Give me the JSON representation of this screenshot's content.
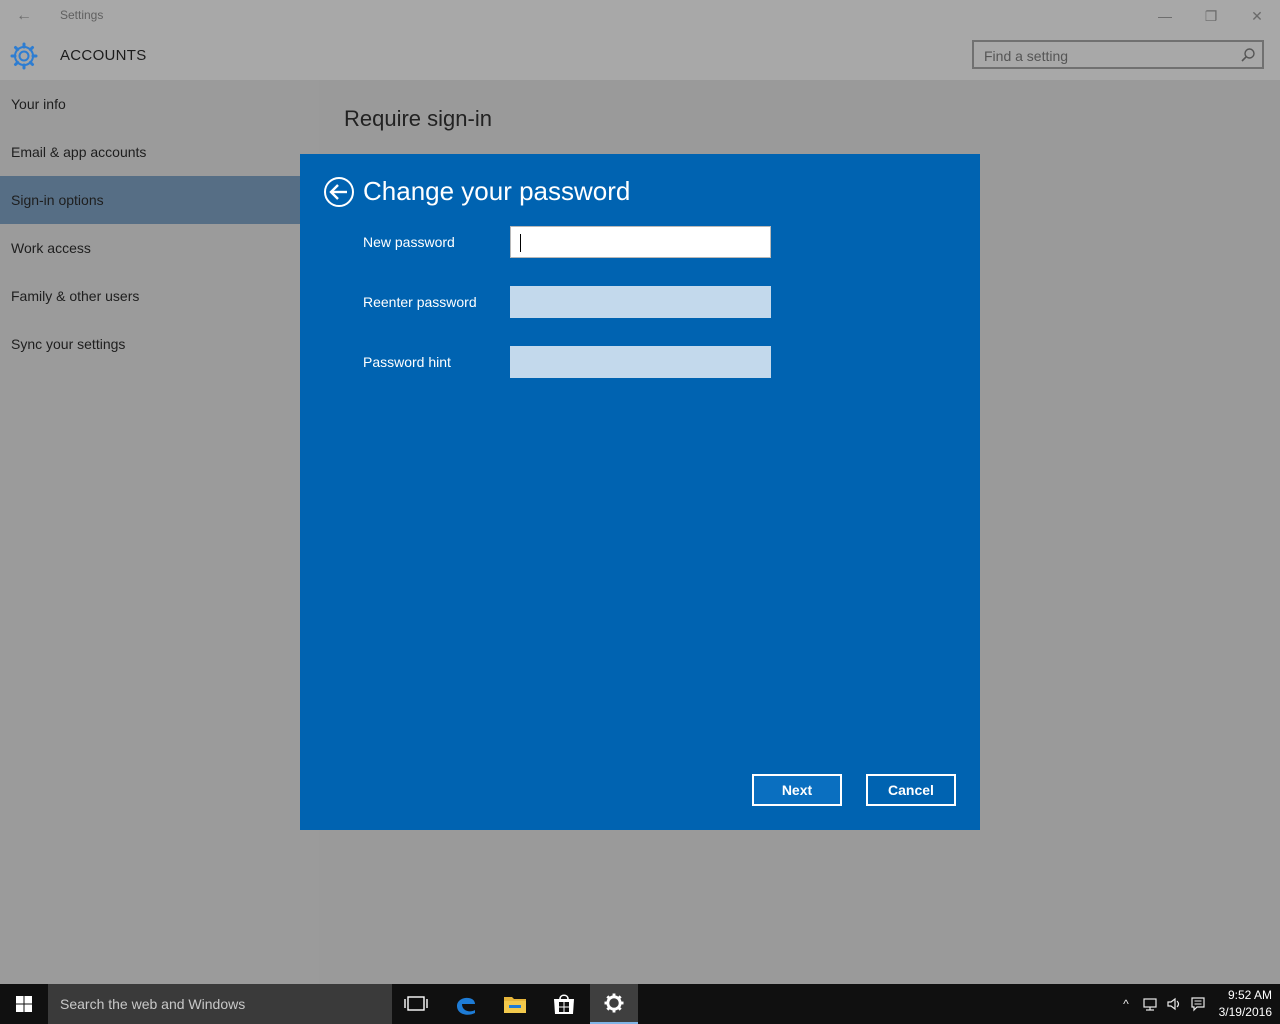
{
  "window": {
    "title": "Settings",
    "back_glyph": "←",
    "minimize_glyph": "—",
    "restore_glyph": "❐",
    "close_glyph": "✕"
  },
  "header": {
    "section": "ACCOUNTS",
    "search_placeholder": "Find a setting"
  },
  "sidebar": {
    "items": [
      {
        "label": "Your info"
      },
      {
        "label": "Email & app accounts"
      },
      {
        "label": "Sign-in options"
      },
      {
        "label": "Work access"
      },
      {
        "label": "Family & other users"
      },
      {
        "label": "Sync your settings"
      }
    ],
    "selected": "Sign-in options"
  },
  "main": {
    "title": "Require sign-in"
  },
  "dialog": {
    "title": "Change your password",
    "fields": [
      {
        "label": "New password",
        "value": ""
      },
      {
        "label": "Reenter password",
        "value": ""
      },
      {
        "label": "Password hint",
        "value": ""
      }
    ],
    "next_label": "Next",
    "cancel_label": "Cancel"
  },
  "taskbar": {
    "search_placeholder": "Search the web and Windows",
    "time": "9:52 AM",
    "date": "3/19/2016",
    "tray_up_glyph": "^"
  },
  "colors": {
    "dialog_bg": "#0063b1",
    "selected_nav": "#566e85",
    "accent": "#2d7dd2"
  },
  "icons": [
    "back-arrow-icon",
    "gear-icon",
    "search-icon",
    "dialog-back-icon",
    "windows-start-icon",
    "task-view-icon",
    "edge-icon",
    "file-explorer-icon",
    "store-icon",
    "settings-gear-icon",
    "network-icon",
    "volume-icon",
    "action-center-icon"
  ]
}
